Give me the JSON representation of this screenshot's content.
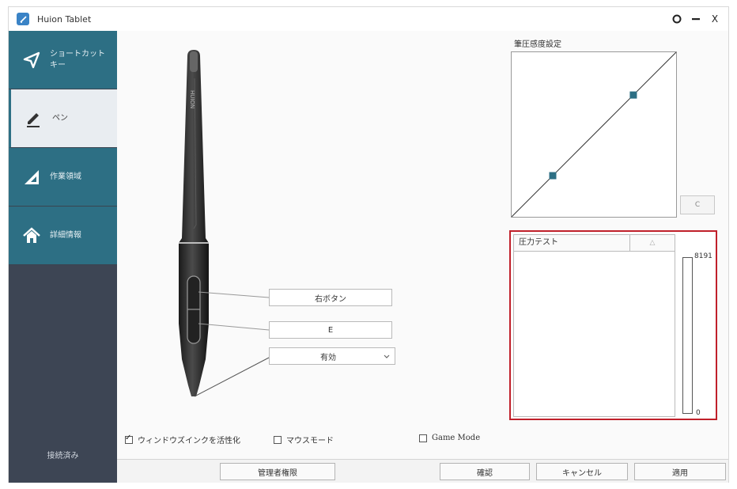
{
  "window": {
    "title": "Huion Tablet",
    "controls": {
      "settings": "O",
      "minimize": "—",
      "close": "X"
    }
  },
  "sidebar": {
    "items": [
      {
        "label": "ショートカット キー",
        "icon": "send-icon"
      },
      {
        "label": "ペン",
        "icon": "pen-icon"
      },
      {
        "label": "作業領域",
        "icon": "triangle-ruler-icon"
      },
      {
        "label": "詳細情報",
        "icon": "home-icon"
      }
    ],
    "active_index": 1,
    "status": "接続済み"
  },
  "pen": {
    "brand_text": "HUION",
    "upper_button_label": "右ボタン",
    "lower_button_label": "E",
    "tip_select_value": "有効"
  },
  "pressure_curve": {
    "title": "筆圧感度設定",
    "reset_label": "C",
    "points": [
      {
        "x": 0.25,
        "y": 0.25
      },
      {
        "x": 0.74,
        "y": 0.74
      }
    ]
  },
  "pressure_test": {
    "title": "圧力テスト",
    "clear_label": "△",
    "max_value": "8191",
    "min_value": "0",
    "current_fraction": 0
  },
  "options": {
    "windows_ink": {
      "label": "ウィンドウズインクを活性化",
      "checked": true,
      "check_mark": "✓"
    },
    "mouse_mode": {
      "label": "マウスモード",
      "checked": false
    },
    "game_mode": {
      "label": "Game Mode",
      "checked": false
    }
  },
  "bottom": {
    "admin_label": "管理者権限",
    "confirm_label": "確認",
    "cancel_label": "キャンセル",
    "apply_label": "適用"
  },
  "colors": {
    "sidebar_bg": "#3d4554",
    "nav_teal": "#2d6f84",
    "curve_point": "#2d6f84",
    "highlight_border": "#c0202a"
  }
}
